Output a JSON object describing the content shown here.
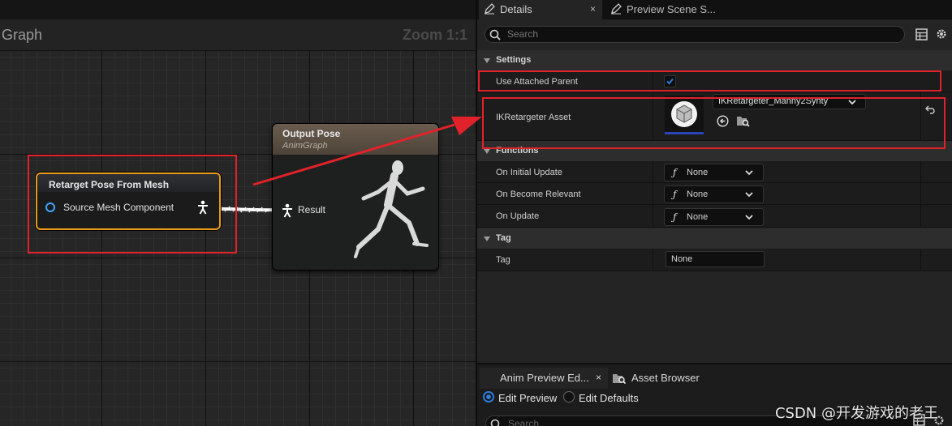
{
  "graph": {
    "title": "Graph",
    "zoom": "Zoom 1:1",
    "retarget_node": {
      "title": "Retarget Pose From Mesh",
      "pin_label": "Source Mesh Component"
    },
    "output_node": {
      "title": "Output Pose",
      "subtitle": "AnimGraph",
      "pin_label": "Result"
    }
  },
  "details": {
    "tabs": [
      {
        "label": "Details",
        "close": "×"
      },
      {
        "label": "Preview Scene S..."
      }
    ],
    "search_placeholder": "Search",
    "sections": {
      "settings": "Settings",
      "functions": "Functions",
      "tag": "Tag"
    },
    "settings": {
      "use_attached_parent": {
        "label": "Use Attached Parent",
        "checked": true
      },
      "ik_asset": {
        "label": "IKRetargeter Asset",
        "value": "IKRetargeter_Manny2Synty"
      }
    },
    "functions": [
      {
        "label": "On Initial Update",
        "value": "None",
        "glyph": "ƒ"
      },
      {
        "label": "On Become Relevant",
        "value": "None",
        "glyph": "ƒ"
      },
      {
        "label": "On Update",
        "value": "None",
        "glyph": "ƒ"
      }
    ],
    "tag": {
      "label": "Tag",
      "value": "None"
    }
  },
  "bottom": {
    "tabs": [
      {
        "label": "Anim Preview Ed...",
        "close": "×"
      },
      {
        "label": "Asset Browser"
      }
    ],
    "radio": [
      {
        "label": "Edit Preview",
        "selected": true
      },
      {
        "label": "Edit Defaults",
        "selected": false
      }
    ],
    "search_placeholder": "Search"
  },
  "watermark": "CSDN @开发游戏的老王",
  "colors": {
    "selection_outline": "#e89b1a",
    "annotation_red": "#e0222a",
    "accent_blue": "#2e7dd8"
  }
}
